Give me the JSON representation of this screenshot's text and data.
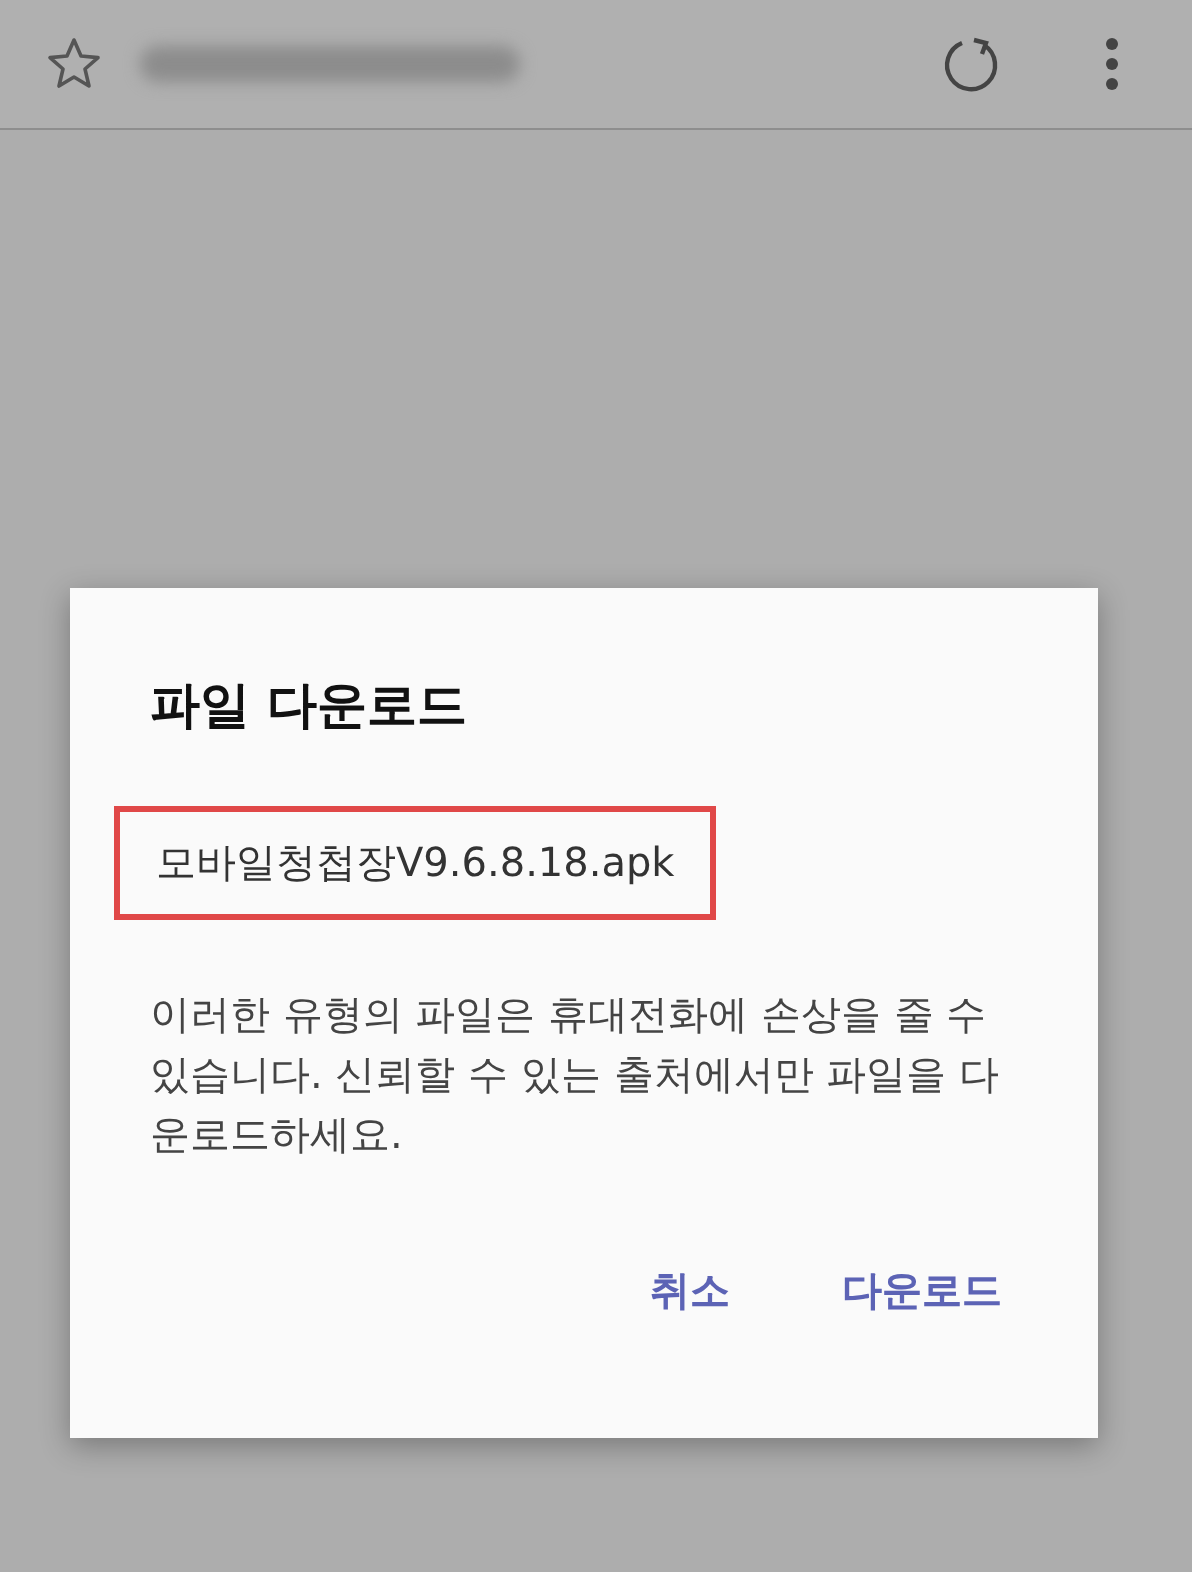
{
  "toolbar": {
    "url_blurred": true
  },
  "dialog": {
    "title": "파일 다운로드",
    "file_name": {
      "text": "모바일청첩장V9.6.8.18.apk",
      "highlighted": true
    },
    "message": "이러한 유형의 파일은 휴대전화에 손상을 줄 수 있습니다. 신뢰할 수 있는 출처에서만 파일을 다운로드하세요.",
    "buttons": [
      "취소",
      "다운로드"
    ]
  }
}
